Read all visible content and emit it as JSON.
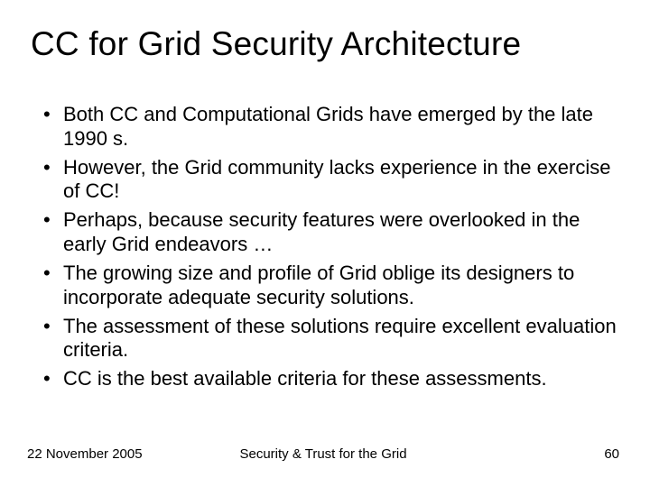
{
  "title": "CC for Grid Security Architecture",
  "bullets": [
    "Both CC and Computational Grids have emerged by the late 1990 s.",
    "However, the Grid community lacks experience in the exercise of CC!",
    "Perhaps, because security features were overlooked in the early Grid endeavors …",
    "The growing size and profile of Grid oblige its designers to incorporate adequate security solutions.",
    "The assessment of these solutions require excellent evaluation criteria.",
    "CC is the best available criteria for these assessments."
  ],
  "footer": {
    "date": "22 November 2005",
    "center": "Security & Trust for the Grid",
    "page": "60"
  }
}
